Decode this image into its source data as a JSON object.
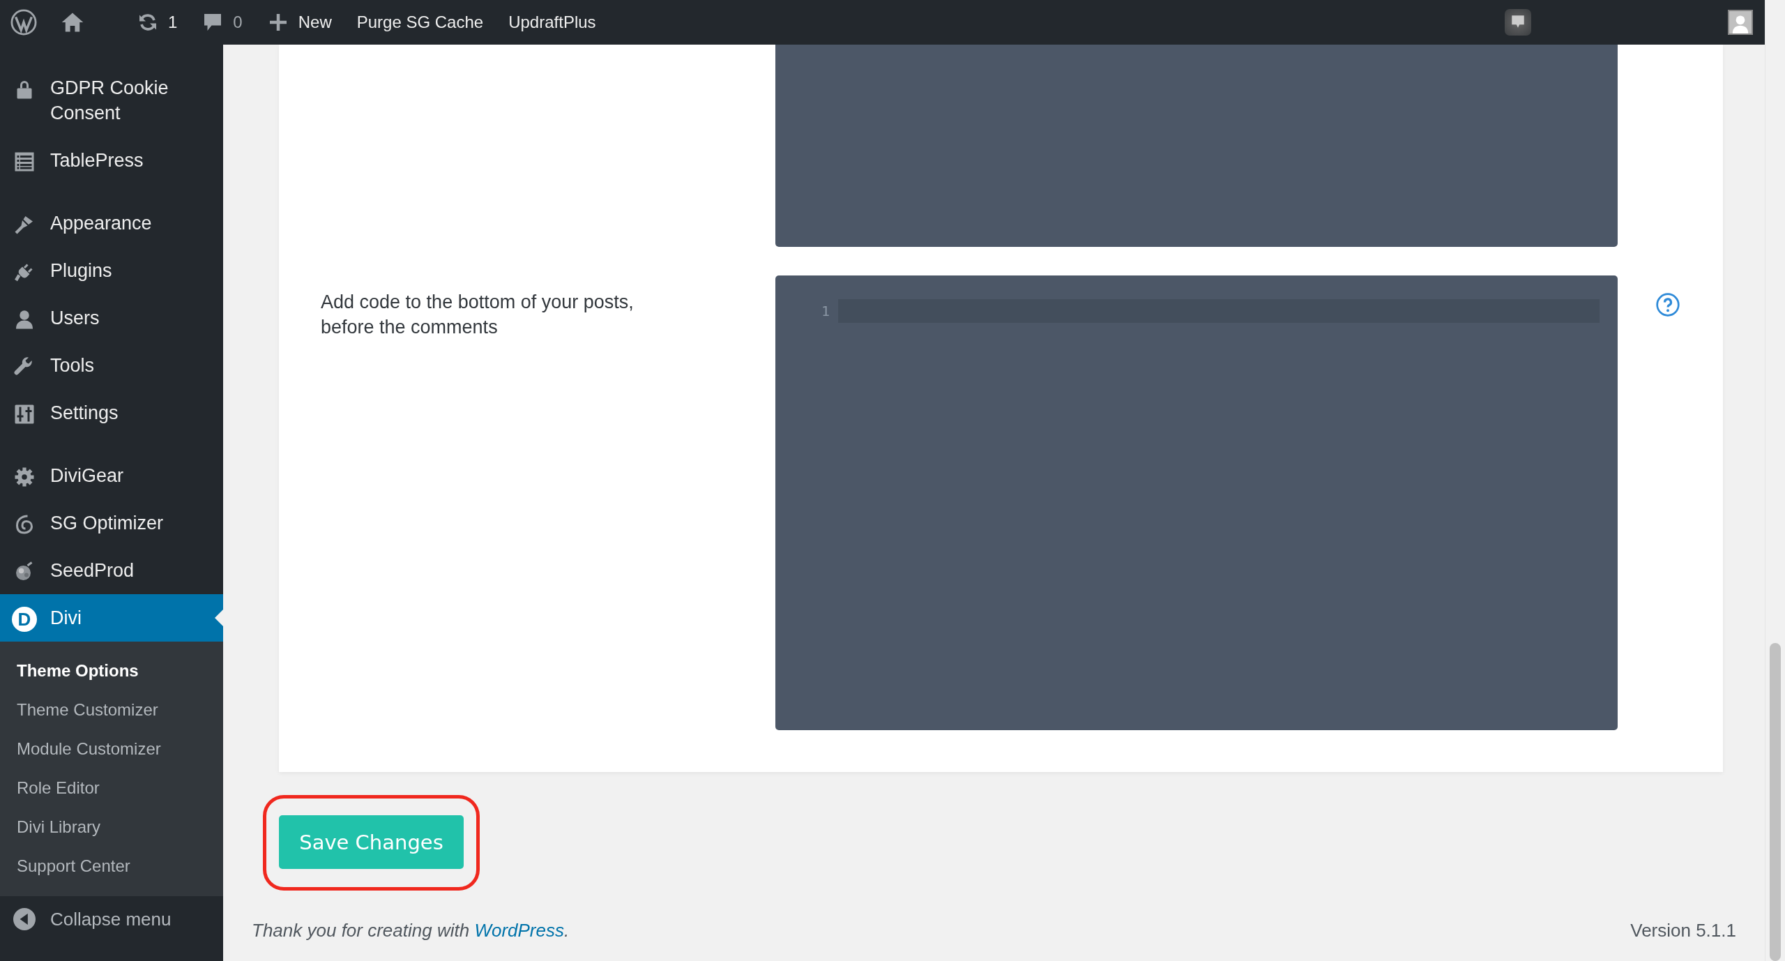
{
  "admin_bar": {
    "items": [
      {
        "kind": "updates",
        "label": "1"
      },
      {
        "kind": "comments",
        "label": "0"
      },
      {
        "kind": "new",
        "label": "New"
      },
      {
        "kind": "text",
        "label": "Purge SG Cache"
      },
      {
        "kind": "text",
        "label": "UpdraftPlus"
      }
    ]
  },
  "sidebar": {
    "menu_groups": [
      {
        "items": [
          {
            "kind": "lock",
            "label": "GDPR Cookie Consent",
            "selected": false
          },
          {
            "kind": "table",
            "label": "TablePress",
            "selected": false
          }
        ]
      },
      {
        "items": [
          {
            "kind": "brush",
            "label": "Appearance",
            "selected": false
          },
          {
            "kind": "plug",
            "label": "Plugins",
            "selected": false
          },
          {
            "kind": "user",
            "label": "Users",
            "selected": false
          },
          {
            "kind": "wrench",
            "label": "Tools",
            "selected": false
          },
          {
            "kind": "sliders",
            "label": "Settings",
            "selected": false
          }
        ]
      },
      {
        "items": [
          {
            "kind": "gear",
            "label": "DiviGear",
            "selected": false
          },
          {
            "kind": "swirl",
            "label": "SG Optimizer",
            "selected": false
          },
          {
            "kind": "seed",
            "label": "SeedProd",
            "selected": false
          },
          {
            "kind": "divi",
            "label": "Divi",
            "logo_letter": "D",
            "selected": true
          }
        ]
      }
    ],
    "submenu": [
      {
        "label": "Theme Options",
        "selected": true
      },
      {
        "label": "Theme Customizer",
        "selected": false
      },
      {
        "label": "Module Customizer",
        "selected": false
      },
      {
        "label": "Role Editor",
        "selected": false
      },
      {
        "label": "Divi Library",
        "selected": false
      },
      {
        "label": "Support Center",
        "selected": false
      }
    ],
    "collapse": "Collapse menu"
  },
  "fields": [
    {
      "kind": "editor"
    },
    {
      "kind": "editor",
      "label": "Add code to the bottom of your posts, before the comments",
      "line_number": "1"
    }
  ],
  "save_button": {
    "label": "Save Changes",
    "highlighted": true
  },
  "footer": {
    "credit_prefix": "Thank you for creating with ",
    "credit_link": "WordPress",
    "credit_suffix": ".",
    "version": "Version 5.1.1"
  }
}
